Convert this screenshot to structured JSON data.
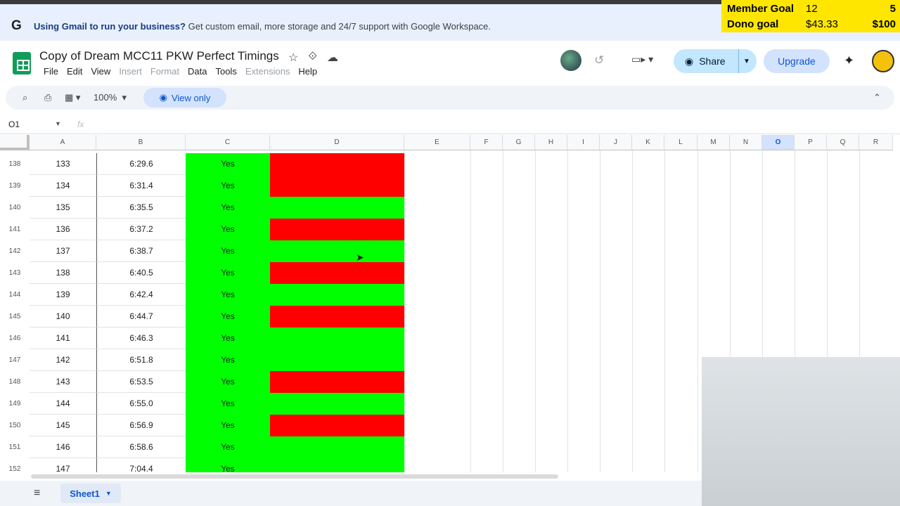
{
  "banner": {
    "icon": "G",
    "bold": "Using Gmail to run your business?",
    "text": " Get custom email, more storage and 24/7 support with Google Workspace."
  },
  "overlay": {
    "member_label": "Member Goal",
    "member_value": "12",
    "member_target": "5",
    "dono_label": "Dono goal",
    "dono_value": "$43.33",
    "dono_target": "$100"
  },
  "doc": {
    "title": "Copy of Dream MCC11 PKW Perfect Timings"
  },
  "menus": [
    {
      "label": "File",
      "enabled": true
    },
    {
      "label": "Edit",
      "enabled": true
    },
    {
      "label": "View",
      "enabled": true
    },
    {
      "label": "Insert",
      "enabled": false
    },
    {
      "label": "Format",
      "enabled": false
    },
    {
      "label": "Data",
      "enabled": true
    },
    {
      "label": "Tools",
      "enabled": true
    },
    {
      "label": "Extensions",
      "enabled": false
    },
    {
      "label": "Help",
      "enabled": true
    }
  ],
  "header": {
    "share_label": "Share",
    "upgrade_label": "Upgrade"
  },
  "toolbar": {
    "zoom": "100%",
    "view_only_label": "View only"
  },
  "formula": {
    "name_box": "O1",
    "fx": "fx"
  },
  "columns": [
    "A",
    "B",
    "C",
    "D",
    "E",
    "F",
    "G",
    "H",
    "I",
    "J",
    "K",
    "L",
    "M",
    "N",
    "O",
    "P",
    "Q",
    "R"
  ],
  "selected_column": "O",
  "rows": [
    {
      "num": "138",
      "a": "133",
      "b": "6:29.6",
      "c": "Yes",
      "d": "red"
    },
    {
      "num": "139",
      "a": "134",
      "b": "6:31.4",
      "c": "Yes",
      "d": "red"
    },
    {
      "num": "140",
      "a": "135",
      "b": "6:35.5",
      "c": "Yes",
      "d": "green"
    },
    {
      "num": "141",
      "a": "136",
      "b": "6:37.2",
      "c": "Yes",
      "d": "red"
    },
    {
      "num": "142",
      "a": "137",
      "b": "6:38.7",
      "c": "Yes",
      "d": "green"
    },
    {
      "num": "143",
      "a": "138",
      "b": "6:40.5",
      "c": "Yes",
      "d": "red"
    },
    {
      "num": "144",
      "a": "139",
      "b": "6:42.4",
      "c": "Yes",
      "d": "green"
    },
    {
      "num": "145",
      "a": "140",
      "b": "6:44.7",
      "c": "Yes",
      "d": "red"
    },
    {
      "num": "146",
      "a": "141",
      "b": "6:46.3",
      "c": "Yes",
      "d": "green"
    },
    {
      "num": "147",
      "a": "142",
      "b": "6:51.8",
      "c": "Yes",
      "d": "green"
    },
    {
      "num": "148",
      "a": "143",
      "b": "6:53.5",
      "c": "Yes",
      "d": "red"
    },
    {
      "num": "149",
      "a": "144",
      "b": "6:55.0",
      "c": "Yes",
      "d": "green"
    },
    {
      "num": "150",
      "a": "145",
      "b": "6:56.9",
      "c": "Yes",
      "d": "red"
    },
    {
      "num": "151",
      "a": "146",
      "b": "6:58.6",
      "c": "Yes",
      "d": "green"
    },
    {
      "num": "152",
      "a": "147",
      "b": "7:04.4",
      "c": "Yes",
      "d": "green"
    }
  ],
  "colors": {
    "green": "#00ff00",
    "red": "#ff0000",
    "accent": "#0b57d0"
  },
  "sheet_tab": {
    "label": "Sheet1"
  }
}
